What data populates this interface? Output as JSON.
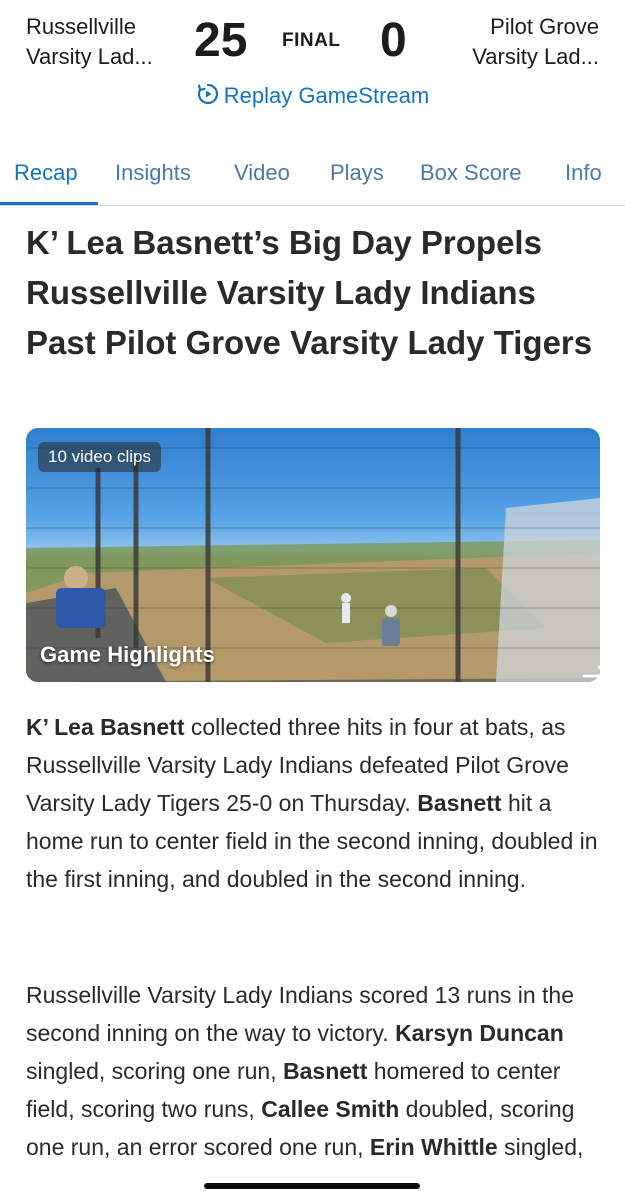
{
  "header": {
    "home_team_line1": "Russellville",
    "home_team_line2": "Varsity Lad...",
    "home_score": "25",
    "status": "FINAL",
    "away_score": "0",
    "away_team_line1": "Pilot Grove",
    "away_team_line2": "Varsity Lad...",
    "replay_label": "Replay GameStream"
  },
  "tabs": [
    {
      "label": "Recap",
      "active": true
    },
    {
      "label": "Insights"
    },
    {
      "label": "Video"
    },
    {
      "label": "Plays"
    },
    {
      "label": "Box Score"
    },
    {
      "label": "Info"
    }
  ],
  "article": {
    "headline": "K’ Lea Basnett’s Big Day Propels Russellville Varsity Lady Indians Past Pilot Grove Varsity Lady Tigers",
    "media": {
      "badge": "10 video clips",
      "title": "Game Highlights"
    },
    "p1": {
      "b1": "K’ Lea Basnett",
      "t1": " collected three hits in four at bats, as Russellville Varsity Lady Indians defeated Pilot Grove Varsity Lady Tigers 25-0 on Thursday. ",
      "b2": "Basnett",
      "t2": " hit a home run to center field in the second inning, doubled in the first inning, and doubled in the second inning."
    },
    "p2": {
      "t0": "Russellville Varsity Lady Indians scored 13 runs in the second inning on the way to victory. ",
      "b1": "Karsyn Duncan",
      "t1": " singled, scoring one run, ",
      "b2": "Basnett",
      "t2": " homered to center field, scoring two runs, ",
      "b3": "Callee Smith",
      "t3": " doubled, scoring one run, an error scored one run, ",
      "b4": "Erin Whittle",
      "t4": " singled,"
    }
  },
  "colors": {
    "accent": "#1473c4",
    "text": "#2a2a2c"
  }
}
